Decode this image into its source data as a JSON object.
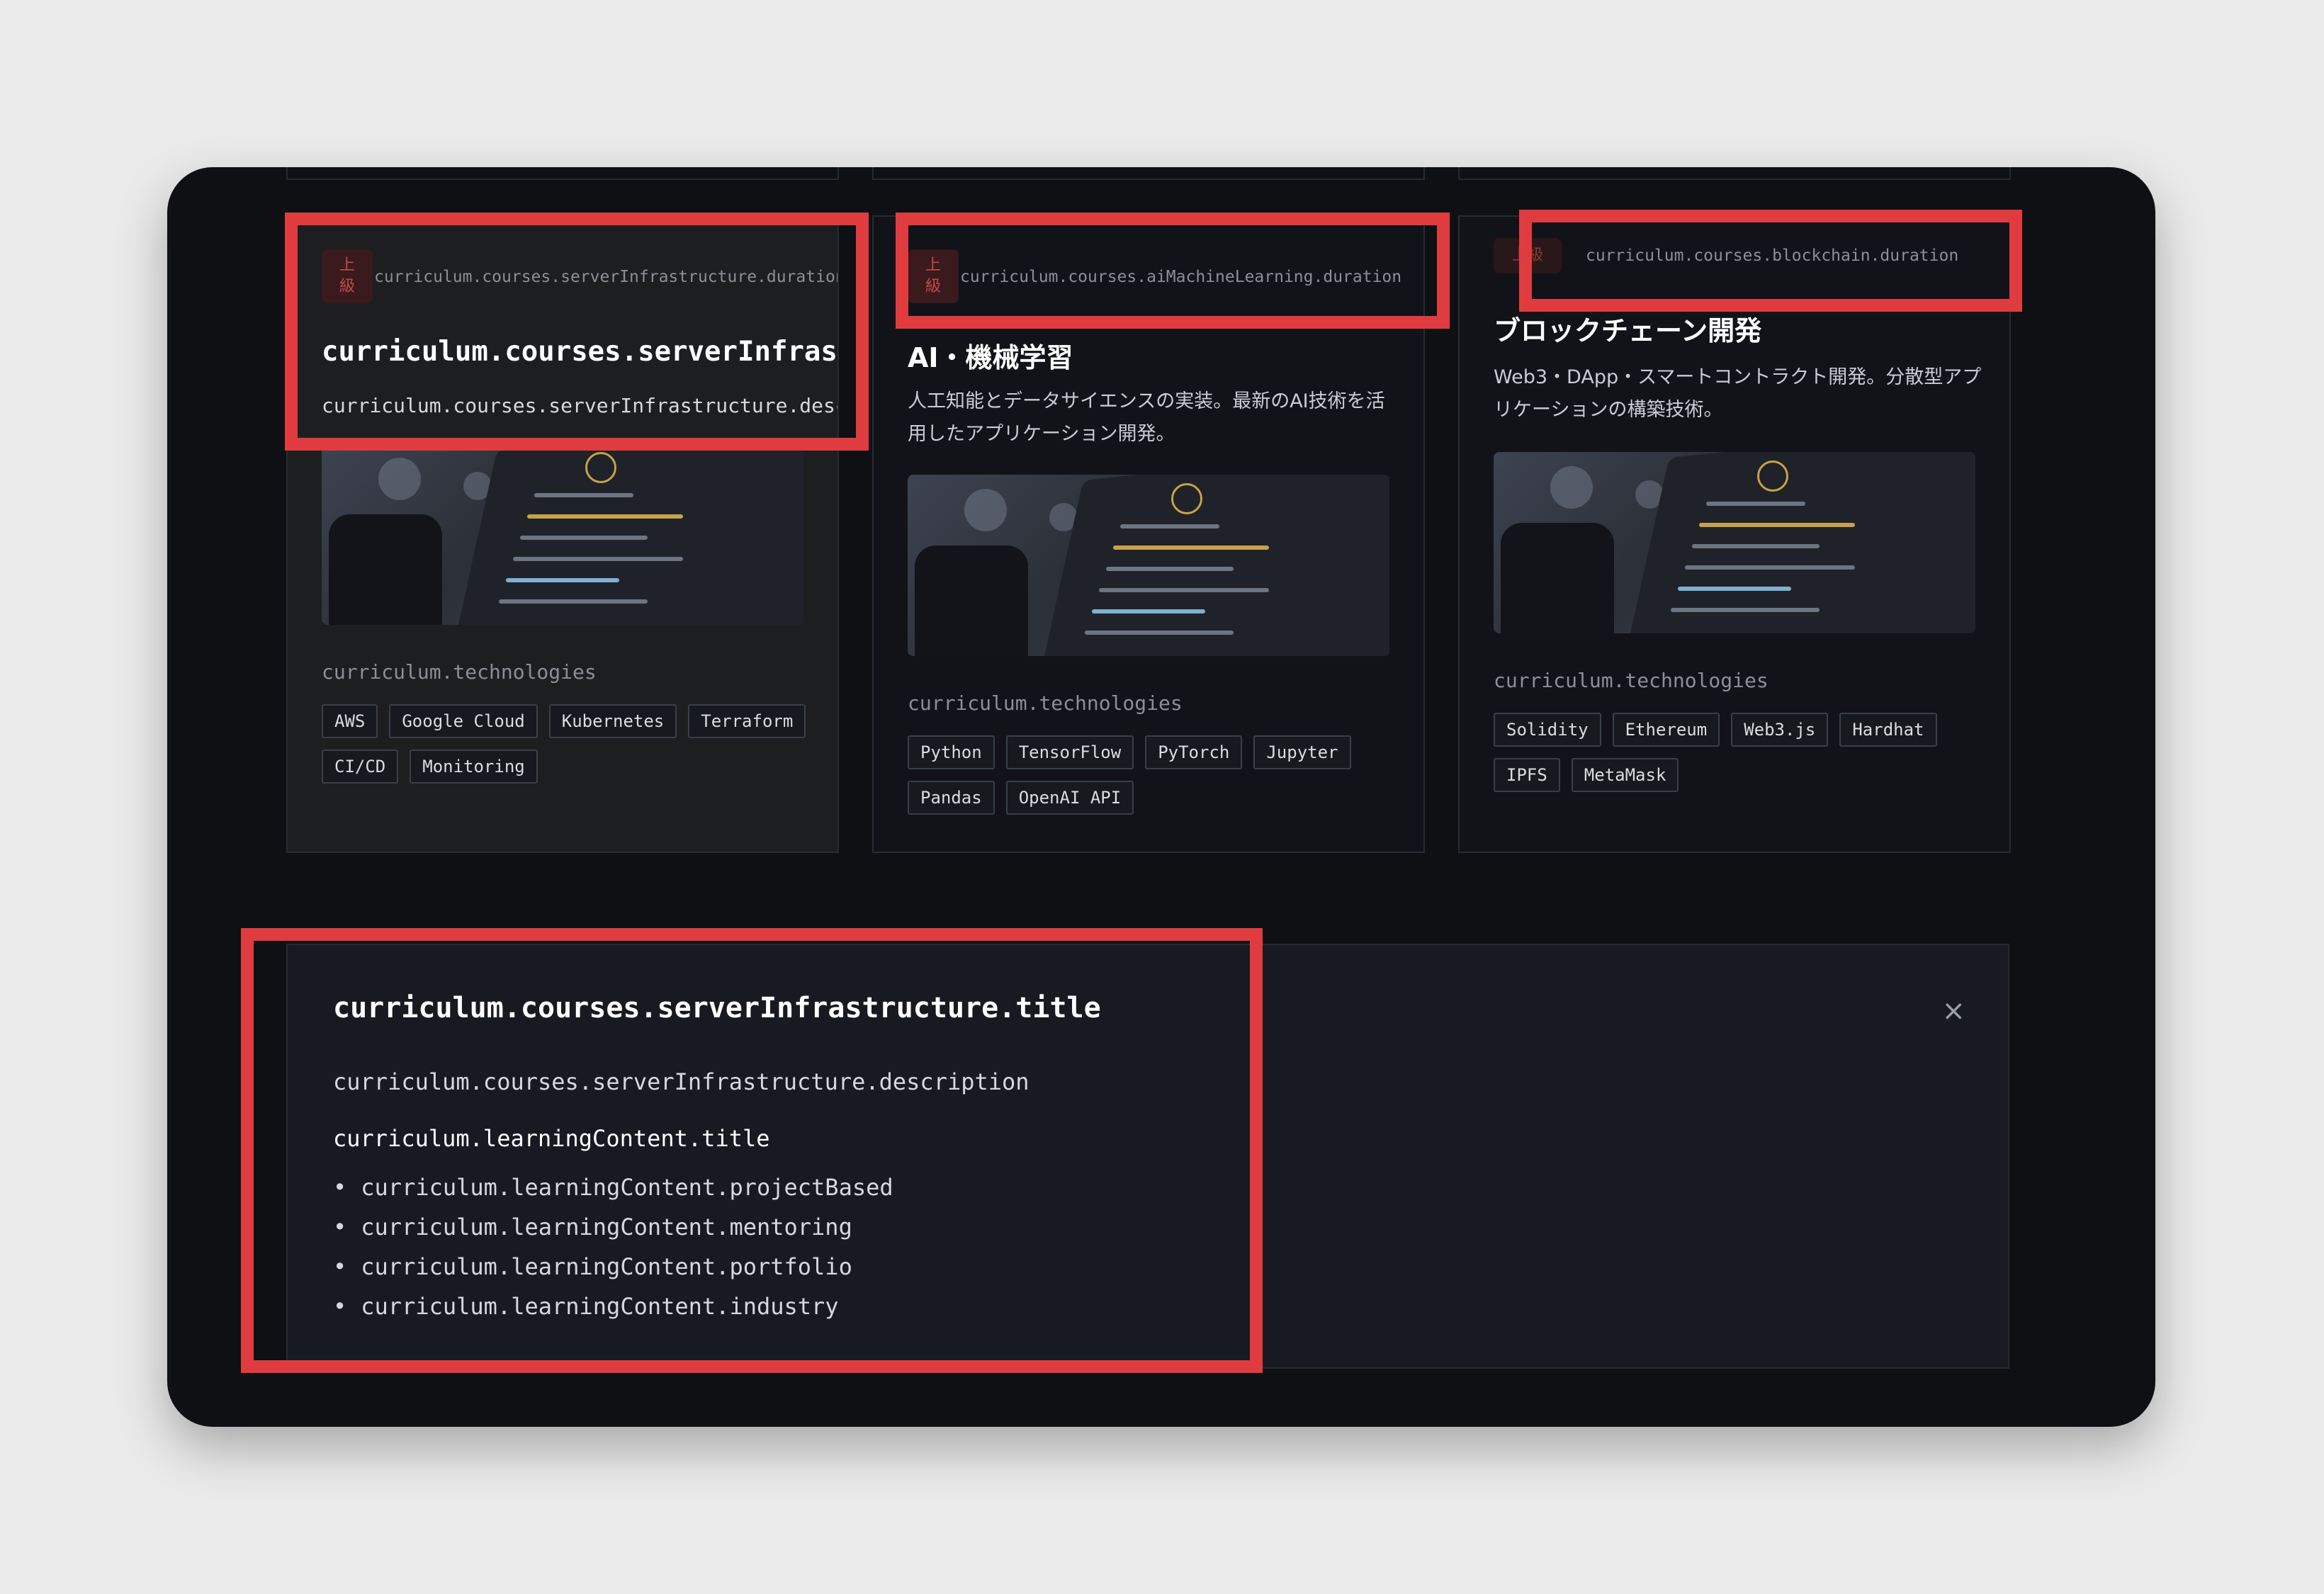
{
  "cards": [
    {
      "badge": "上\n級",
      "duration": "curriculum.courses.serverInfrastructure.duration",
      "title": "curriculum.courses.serverInfrastructure.title",
      "description": "curriculum.courses.serverInfrastructure.description",
      "tech_label": "curriculum.technologies",
      "tags": [
        "AWS",
        "Google Cloud",
        "Kubernetes",
        "Terraform",
        "CI/CD",
        "Monitoring"
      ]
    },
    {
      "badge": "上\n級",
      "duration": "curriculum.courses.aiMachineLearning.duration",
      "title": "AI・機械学習",
      "description": "人工知能とデータサイエンスの実装。最新のAI技術を活用したアプリケーション開発。",
      "tech_label": "curriculum.technologies",
      "tags": [
        "Python",
        "TensorFlow",
        "PyTorch",
        "Jupyter",
        "Pandas",
        "OpenAI API"
      ]
    },
    {
      "badge": "上級",
      "duration": "curriculum.courses.blockchain.duration",
      "title": "ブロックチェーン開発",
      "description": "Web3・DApp・スマートコントラクト開発。分散型アプリケーションの構築技術。",
      "tech_label": "curriculum.technologies",
      "tags": [
        "Solidity",
        "Ethereum",
        "Web3.js",
        "Hardhat",
        "IPFS",
        "MetaMask"
      ]
    }
  ],
  "detail": {
    "title": "curriculum.courses.serverInfrastructure.title",
    "description": "curriculum.courses.serverInfrastructure.description",
    "content_title": "curriculum.learningContent.title",
    "items": [
      "curriculum.learningContent.projectBased",
      "curriculum.learningContent.mentoring",
      "curriculum.learningContent.portfolio",
      "curriculum.learningContent.industry"
    ],
    "close": "×"
  },
  "colors": {
    "highlight": "#e03c3f",
    "badge_text": "#c54a4a",
    "background": "#0e1014"
  }
}
